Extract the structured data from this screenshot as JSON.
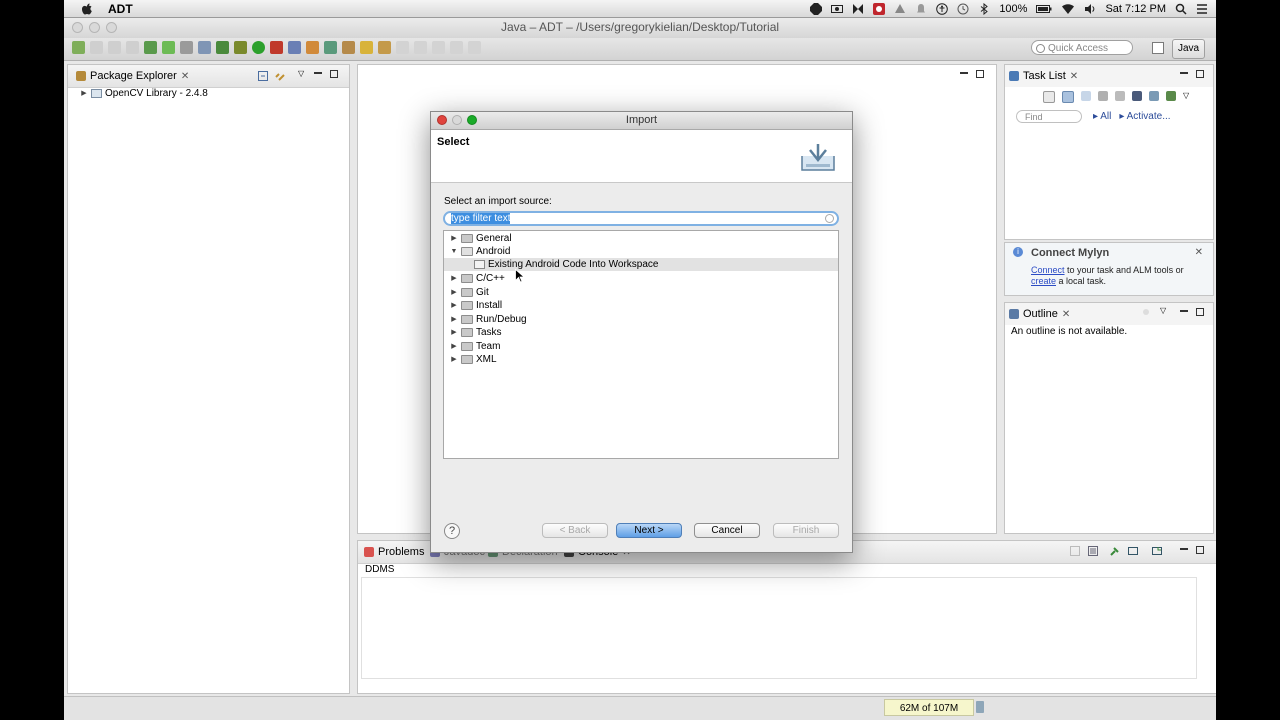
{
  "menubar": {
    "app_name": "ADT",
    "battery": "100%",
    "clock": "Sat 7:12 PM"
  },
  "window": {
    "title": "Java – ADT – /Users/gregorykielian/Desktop/Tutorial"
  },
  "toolbar": {
    "quick_access_placeholder": "Quick Access",
    "perspective_label": "Java"
  },
  "package_explorer": {
    "title": "Package Explorer",
    "items": [
      {
        "label": "OpenCV Library - 2.4.8"
      }
    ]
  },
  "task_list": {
    "title": "Task List",
    "find_placeholder": "Find",
    "filter_all": "All",
    "filter_activate": "Activate..."
  },
  "mylyn": {
    "title": "Connect Mylyn",
    "connect_link": "Connect",
    "line1_rest": " to your task and ALM tools or",
    "create_link": "create",
    "line2_rest": " a local task."
  },
  "outline": {
    "title": "Outline",
    "message": "An outline is not available."
  },
  "bottom_panel": {
    "tabs": [
      "Problems",
      "Javadoc",
      "Declaration",
      "Console"
    ],
    "console_name": "DDMS"
  },
  "dialog": {
    "title": "Import",
    "banner_title": "Select",
    "source_label": "Select an import source:",
    "filter_text": "type filter text",
    "tree": [
      {
        "label": "General",
        "expanded": false
      },
      {
        "label": "Android",
        "expanded": true
      },
      {
        "label": "Existing Android Code Into Workspace",
        "child": true
      },
      {
        "label": "C/C++",
        "expanded": false
      },
      {
        "label": "Git",
        "expanded": false
      },
      {
        "label": "Install",
        "expanded": false
      },
      {
        "label": "Run/Debug",
        "expanded": false
      },
      {
        "label": "Tasks",
        "expanded": false
      },
      {
        "label": "Team",
        "expanded": false
      },
      {
        "label": "XML",
        "expanded": false
      }
    ],
    "buttons": {
      "back": "< Back",
      "next": "Next >",
      "cancel": "Cancel",
      "finish": "Finish"
    }
  },
  "statusbar": {
    "heap": "62M of 107M"
  },
  "colors": {
    "accent": "#3d8ee0",
    "default_button": "#5f9fe6",
    "close_red": "#e0443e",
    "min_yellow": "#dea123",
    "max_green": "#1aab29"
  }
}
